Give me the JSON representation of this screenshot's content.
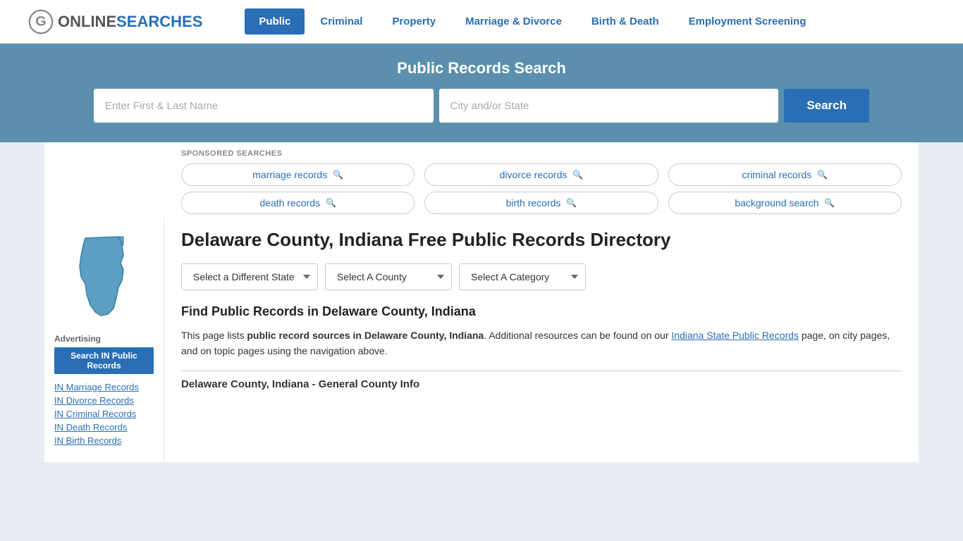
{
  "header": {
    "logo_text_plain": "ONLINE",
    "logo_text_brand": "SEARCHES",
    "nav_items": [
      {
        "label": "Public",
        "active": true
      },
      {
        "label": "Criminal",
        "active": false
      },
      {
        "label": "Property",
        "active": false
      },
      {
        "label": "Marriage & Divorce",
        "active": false
      },
      {
        "label": "Birth & Death",
        "active": false
      },
      {
        "label": "Employment Screening",
        "active": false
      }
    ]
  },
  "search_banner": {
    "title": "Public Records Search",
    "name_placeholder": "Enter First & Last Name",
    "location_placeholder": "City and/or State",
    "button_label": "Search"
  },
  "sponsored": {
    "label": "SPONSORED SEARCHES",
    "items": [
      "marriage records",
      "divorce records",
      "criminal records",
      "death records",
      "birth records",
      "background search"
    ]
  },
  "directory": {
    "heading": "Delaware County, Indiana Free Public Records Directory",
    "dropdown_state": "Select a Different State",
    "dropdown_county": "Select A County",
    "dropdown_category": "Select A Category",
    "find_heading": "Find Public Records in Delaware County, Indiana",
    "find_text_part1": "This page lists ",
    "find_text_bold": "public record sources in Delaware County, Indiana",
    "find_text_part2": ". Additional resources can be found on our ",
    "find_text_link": "Indiana State Public Records",
    "find_text_part3": " page, on city pages, and on topic pages using the navigation above.",
    "general_info_label": "Delaware County, Indiana - General County Info"
  },
  "sidebar": {
    "advertising_label": "Advertising",
    "btn_label": "Search IN Public Records",
    "links": [
      "IN Marriage Records",
      "IN Divorce Records",
      "IN Criminal Records",
      "IN Death Records",
      "IN Birth Records"
    ]
  }
}
